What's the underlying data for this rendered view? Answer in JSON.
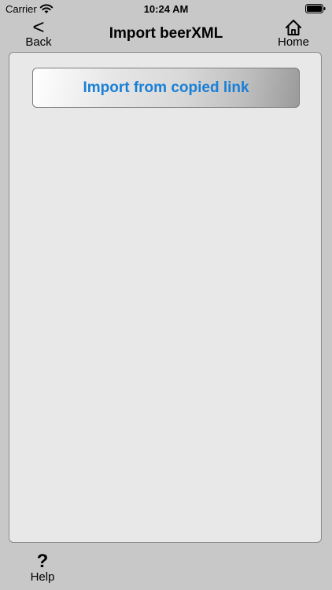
{
  "status_bar": {
    "carrier": "Carrier",
    "time": "10:24 AM"
  },
  "nav": {
    "back_label": "Back",
    "back_icon": "<",
    "title": "Import beerXML",
    "home_label": "Home"
  },
  "main": {
    "import_button_label": "Import from copied link"
  },
  "footer": {
    "help_icon": "?",
    "help_label": "Help"
  },
  "colors": {
    "background": "#c8c8c8",
    "panel": "#e8e8e8",
    "button_text": "#1a7fd6"
  },
  "icons": {
    "wifi": "wifi-icon",
    "battery": "battery-icon",
    "home": "home-icon",
    "back": "chevron-left-icon",
    "help": "question-mark-icon"
  }
}
